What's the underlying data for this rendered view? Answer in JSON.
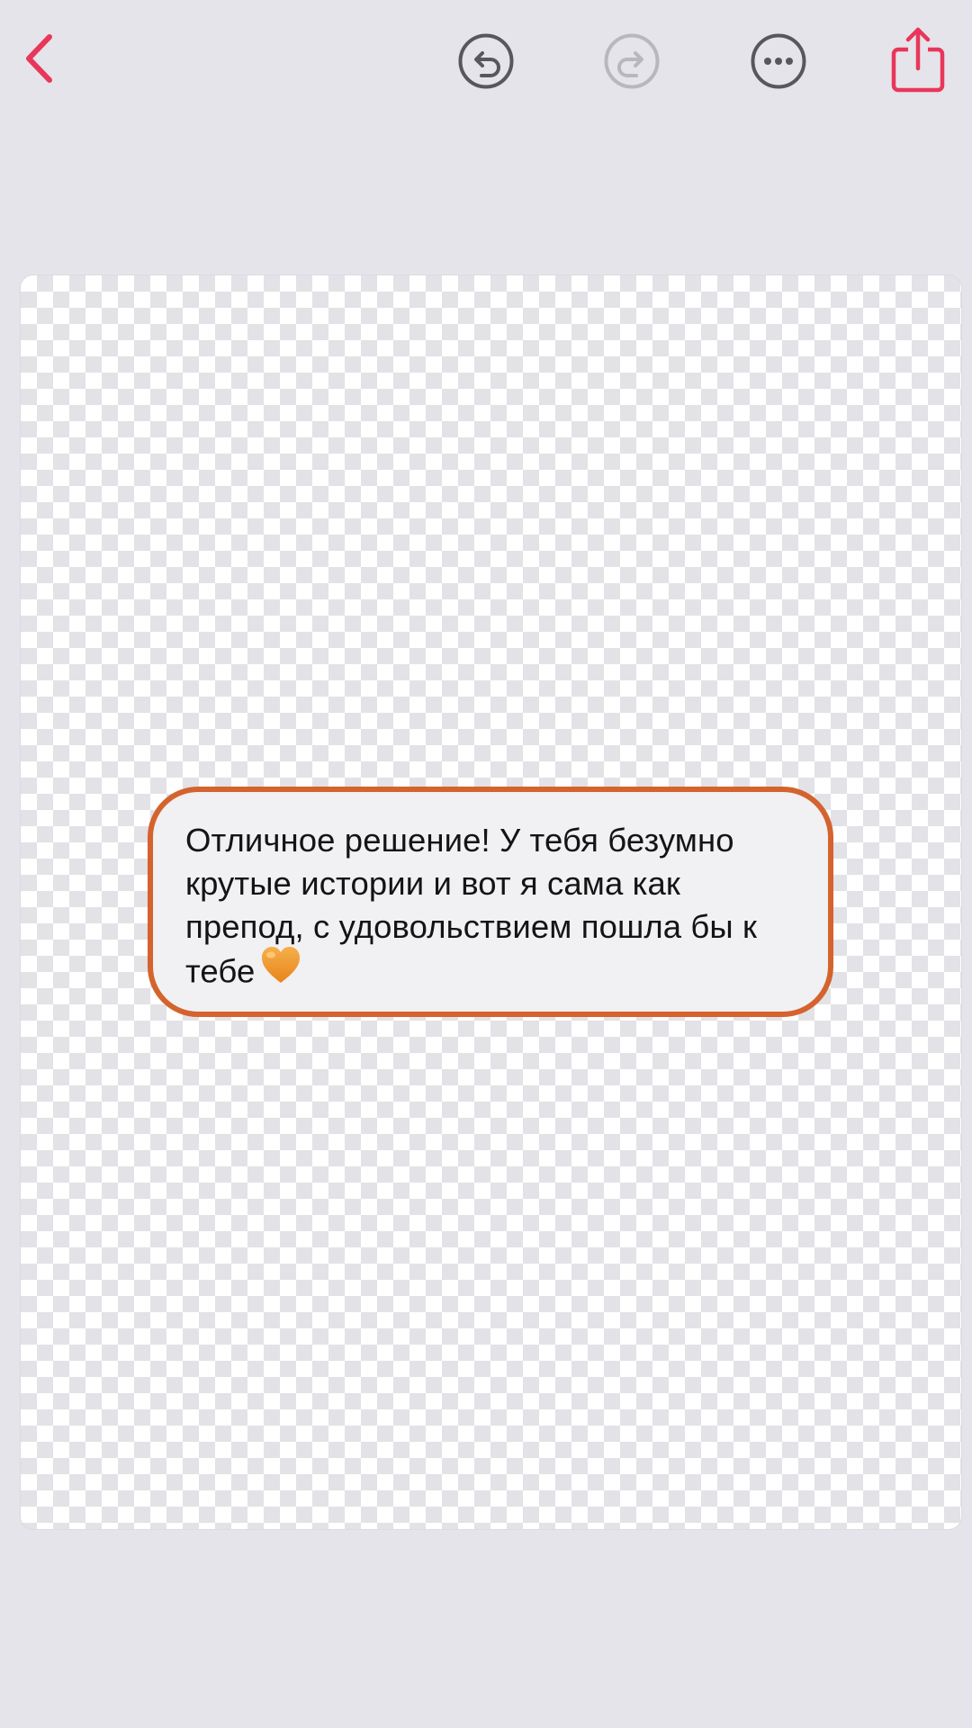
{
  "toolbar": {
    "back_icon": "chevron-left-icon",
    "undo_icon": "undo-icon",
    "redo_icon": "redo-icon",
    "redo_enabled": false,
    "more_icon": "ellipsis-circle-icon",
    "share_icon": "share-icon"
  },
  "colors": {
    "accent": "#e8375a",
    "icon_gray": "#58585c",
    "icon_disabled": "#b8b8bc",
    "background": "#e5e4ea",
    "bubble_border": "#d4632e",
    "bubble_fill": "#f1f0f2",
    "heart": "#f09a2a"
  },
  "message": {
    "text": "Отличное решение! У тебя безумно крутые истории и вот я сама как препод, с удовольствием пошла бы к тебе",
    "emoji_icon": "orange-heart-icon"
  }
}
